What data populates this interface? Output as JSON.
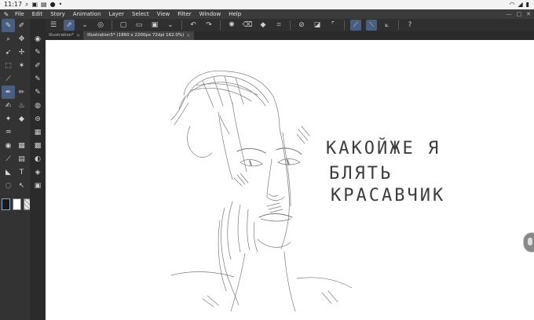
{
  "status_bar": {
    "time": "11:17",
    "icons": [
      "search-icon",
      "image-icon",
      "gallery-icon",
      "chat-icon",
      "more-icon"
    ],
    "right_icons": [
      "wifi-icon",
      "signal-icon",
      "battery-icon"
    ]
  },
  "menu": {
    "items": [
      "File",
      "Edit",
      "Story",
      "Animation",
      "Layer",
      "Select",
      "View",
      "Filter",
      "Window",
      "Help"
    ]
  },
  "tabs": [
    {
      "label": "Illustration*",
      "close": "×"
    },
    {
      "label": "Illustration5* (1860 x 2200px 72dpi 162.0%)",
      "close": "×"
    }
  ],
  "canvas": {
    "text_lines": [
      "КАКОЙЖЕ Я",
      "БЛЯТЬ",
      "КРАСАВЧИК"
    ]
  },
  "colors": {
    "main": "#1a1a1a",
    "sub": "#ffffff",
    "accent": "#4a5f80"
  }
}
